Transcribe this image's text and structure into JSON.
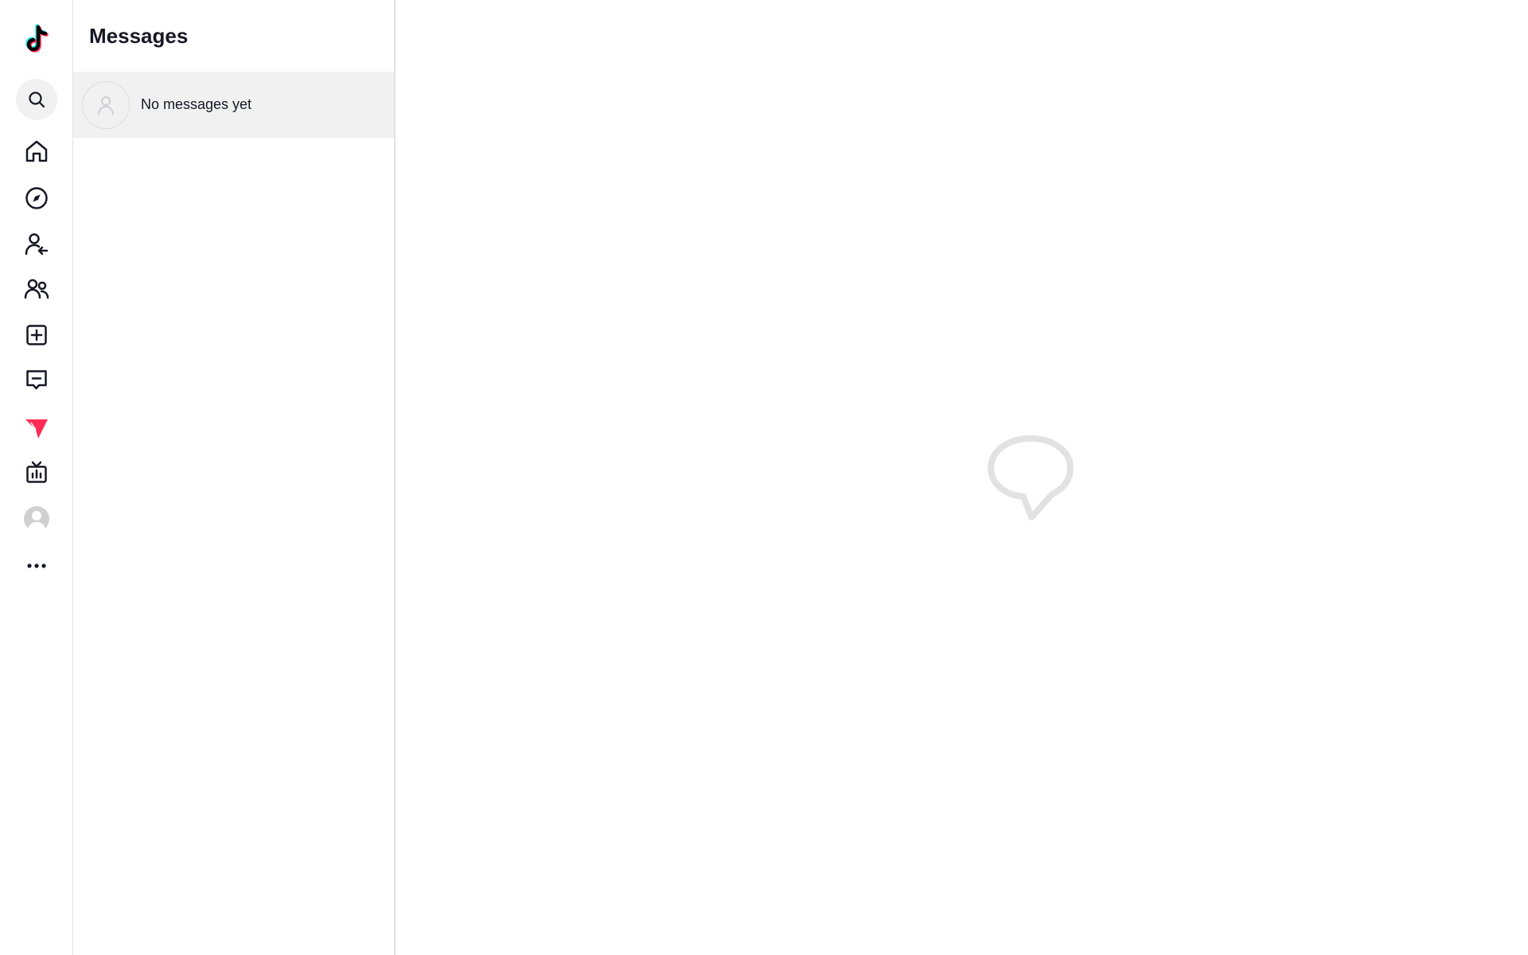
{
  "app": {
    "logo_icon": "tiktok-logo-icon",
    "accent_color": "#fe2c55"
  },
  "rail": {
    "items": [
      {
        "icon": "search-icon"
      },
      {
        "icon": "home-icon"
      },
      {
        "icon": "explore-compass-icon"
      },
      {
        "icon": "following-icon"
      },
      {
        "icon": "friends-icon"
      },
      {
        "icon": "upload-icon"
      },
      {
        "icon": "activity-icon"
      },
      {
        "icon": "messages-icon",
        "active": true
      },
      {
        "icon": "live-icon"
      },
      {
        "icon": "profile-avatar-icon"
      },
      {
        "icon": "more-icon"
      }
    ]
  },
  "messages": {
    "title": "Messages",
    "empty_row_label": "No messages yet"
  },
  "main": {
    "empty_state_icon": "chat-bubble-icon"
  }
}
